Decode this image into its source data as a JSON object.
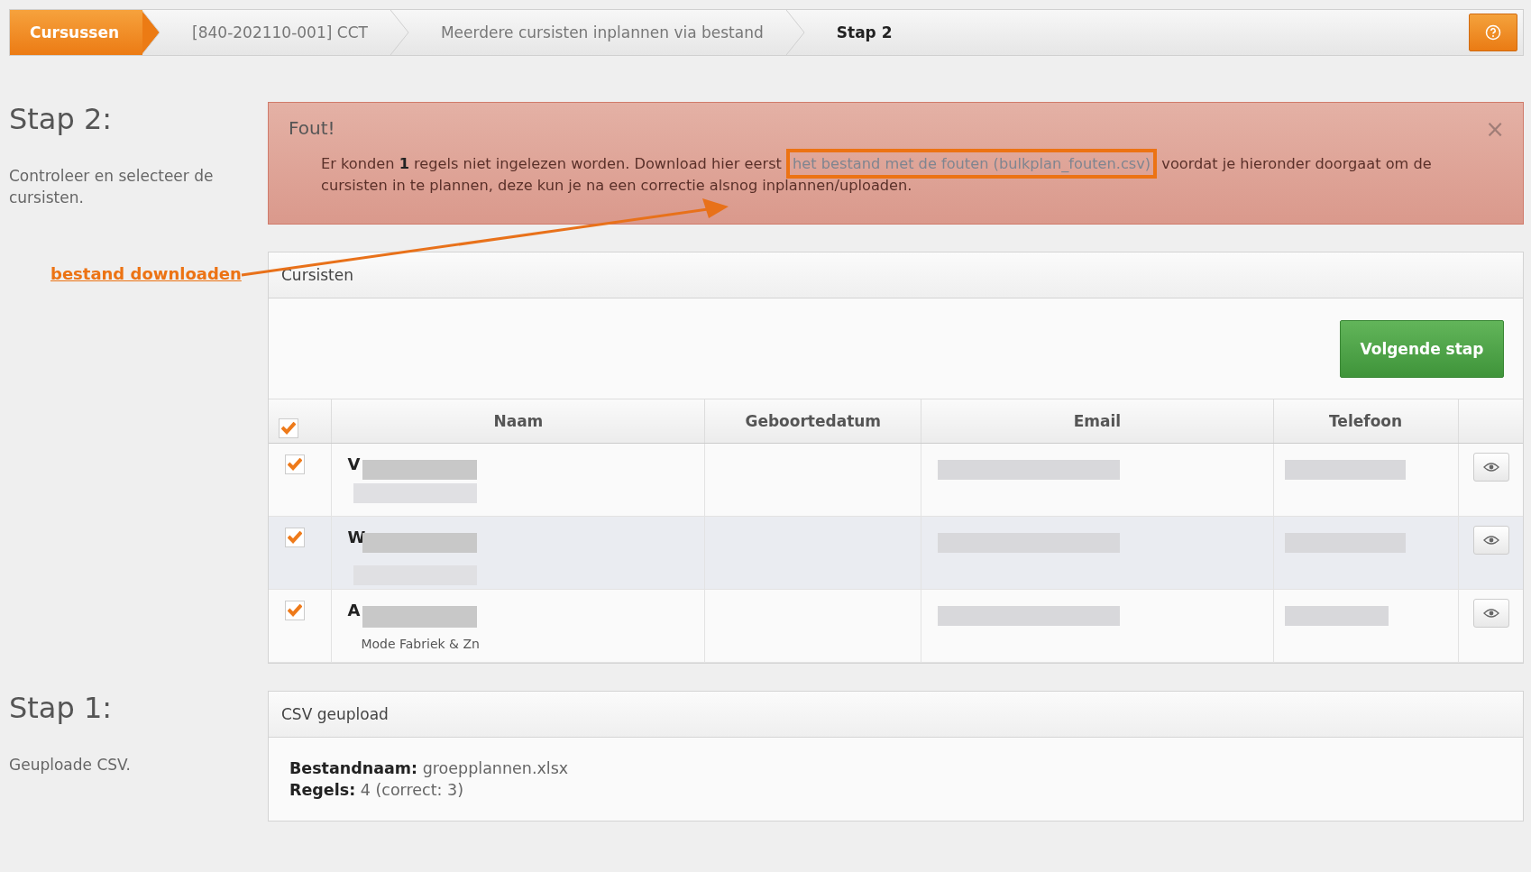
{
  "breadcrumb": [
    {
      "label": "Cursussen",
      "selected": true
    },
    {
      "label": "[840-202110-001] CCT",
      "selected": false
    },
    {
      "label": "Meerdere cursisten inplannen via bestand",
      "selected": false
    },
    {
      "label": "Stap 2",
      "selected": false
    }
  ],
  "step2": {
    "heading": "Stap 2:",
    "description": "Controleer en selecteer de cursisten."
  },
  "alert": {
    "title": "Fout!",
    "close": "×",
    "before": "Er konden **1** regels niet ingelezen worden. Download hier eerst",
    "link": "het bestand met de fouten (bulkplan_fouten.csv)",
    "after": "voordat je hieronder doorgaat om de cursisten in te plannen, deze kun je na een correctie alsnog inplannen/uploaden."
  },
  "annotation": {
    "label": "bestand downloaden"
  },
  "students": {
    "title": "Cursisten",
    "button": "Volgende stap",
    "all_checked": true,
    "columns": [
      "Naam",
      "Geboortedatum",
      "Email",
      "Telefoon"
    ],
    "rows": [
      {
        "checked": true,
        "hovered": false,
        "name": "V",
        "company": ""
      },
      {
        "checked": true,
        "hovered": true,
        "name": "W",
        "company": ""
      },
      {
        "checked": true,
        "hovered": false,
        "name": "A",
        "company": "Mode Fabriek & Zn"
      }
    ]
  },
  "step1": {
    "heading": "Stap 1:",
    "description": "Geuploade CSV.",
    "panel_title": "CSV geupload",
    "fields": [
      {
        "label": "Bestandnaam:",
        "value": "groepplannen.xlsx"
      },
      {
        "label": "Regels:",
        "value": "4 (correct: 3)"
      }
    ]
  }
}
